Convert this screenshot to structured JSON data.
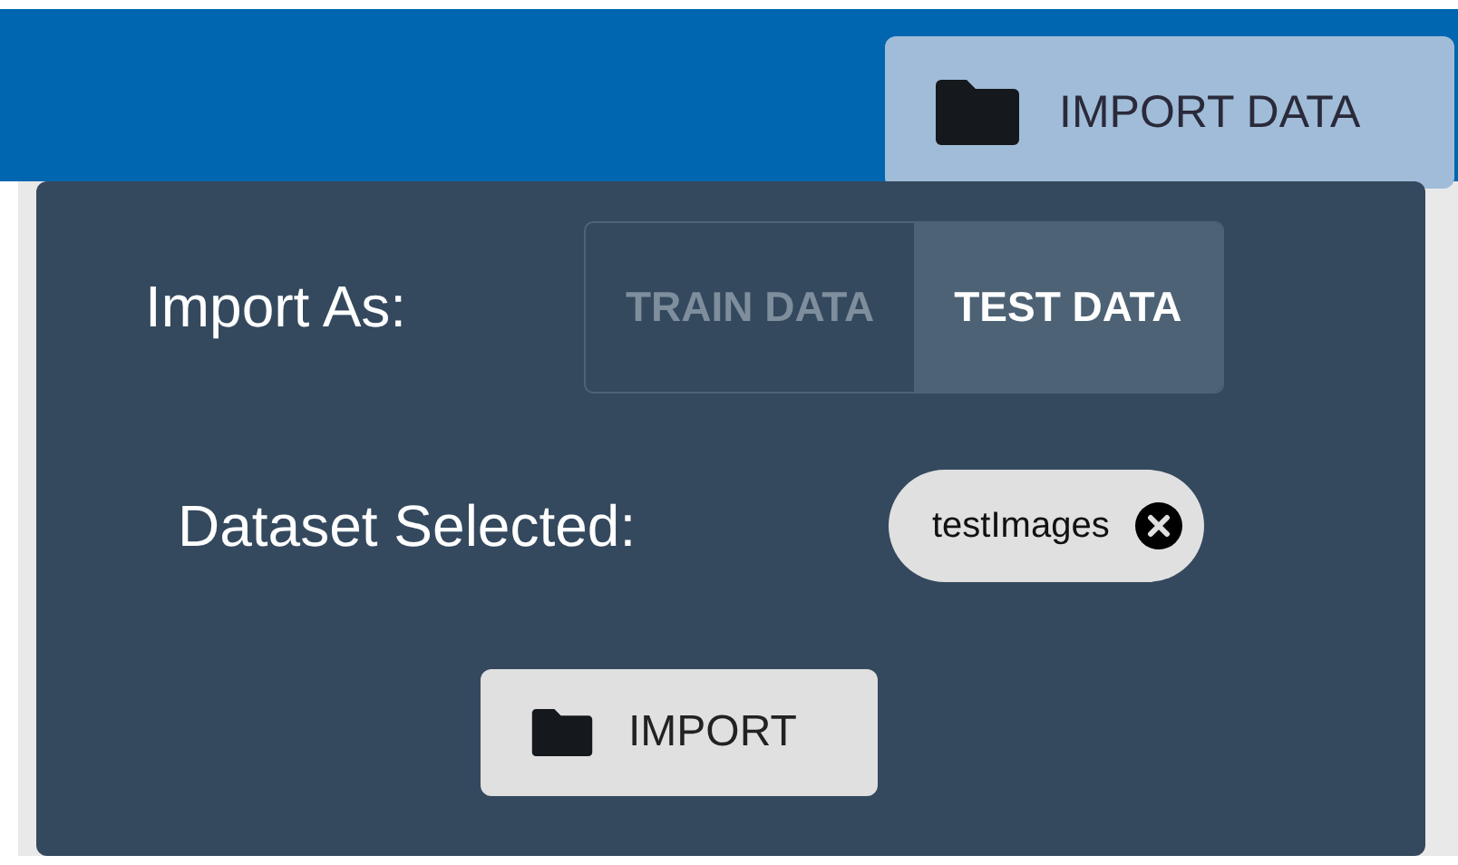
{
  "header": {
    "import_button": "IMPORT DATA"
  },
  "popover": {
    "import_as_label": "Import As:",
    "modes": [
      {
        "label": "TRAIN DATA",
        "selected": false
      },
      {
        "label": "TEST DATA",
        "selected": true
      }
    ],
    "dataset_label": "Dataset Selected:",
    "dataset_chip": "testImages",
    "import_button": "IMPORT"
  }
}
